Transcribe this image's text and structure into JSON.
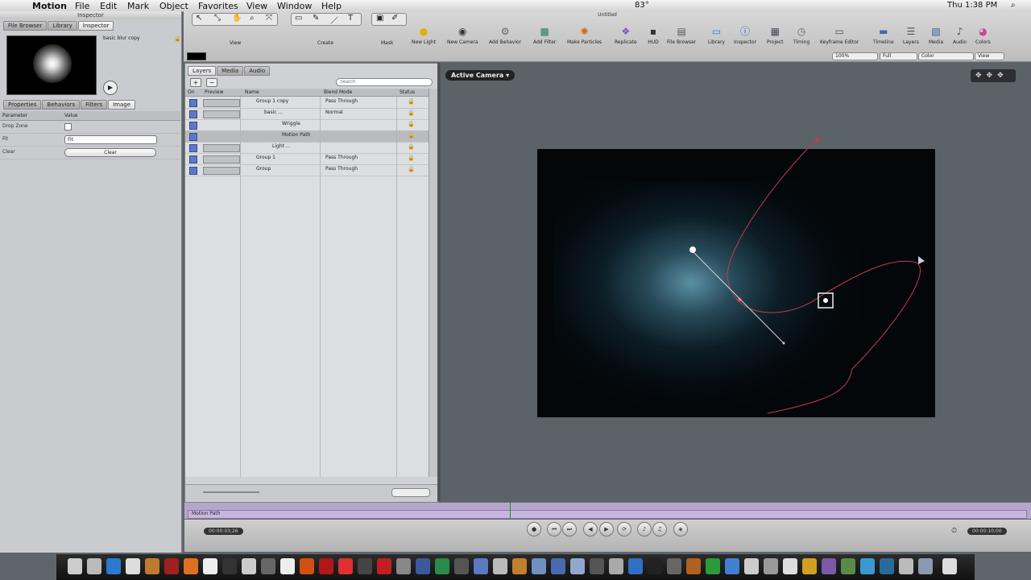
{
  "menubar": {
    "app": "Motion",
    "items": [
      "File",
      "Edit",
      "Mark",
      "Object",
      "Favorites",
      "View",
      "Window",
      "Help"
    ],
    "temp": "83°",
    "clock": "Thu 1:38 PM",
    "window_title": "Untitled"
  },
  "inspector": {
    "title": "Inspector",
    "top_tabs": [
      "File Browser",
      "Library",
      "Inspector"
    ],
    "preview_name": "basic blur copy",
    "sub_tabs": [
      "Properties",
      "Behaviors",
      "Filters",
      "Image"
    ],
    "param_header": "Parameter",
    "value_header": "Value",
    "rows": [
      {
        "label": "Drop Zone"
      },
      {
        "label": "Fit",
        "value": "Fit"
      },
      {
        "label": "Clear",
        "button": "Clear"
      }
    ]
  },
  "toolbar": {
    "group_labels": [
      "View",
      "Create",
      "Mask"
    ],
    "buttons": [
      "New Light",
      "New Camera",
      "Add Behavior",
      "Add Filter",
      "Make Particles",
      "Replicate",
      "HUD",
      "File Browser",
      "Library",
      "Inspector",
      "Project",
      "Timing",
      "Keyframe Editor",
      "Timeline",
      "Layers",
      "Media",
      "Audio",
      "Colors"
    ],
    "zoom": "100%",
    "resolution": "Full",
    "channel": "Color",
    "view": "View"
  },
  "layers": {
    "tabs": [
      "Layers",
      "Media",
      "Audio"
    ],
    "search_placeholder": "Search",
    "columns": [
      "On",
      "Preview",
      "Name",
      "Blend Mode",
      "Status"
    ],
    "rows": [
      {
        "name": "Group 1 copy",
        "blend": "Pass Through",
        "indent": 0
      },
      {
        "name": "basic ...",
        "blend": "Normal",
        "indent": 1
      },
      {
        "name": "Wriggle",
        "blend": "",
        "indent": 2
      },
      {
        "name": "Motion Path",
        "blend": "",
        "indent": 2,
        "selected": true
      },
      {
        "name": "Light ...",
        "blend": "",
        "indent": 1
      },
      {
        "name": "Group 1",
        "blend": "Pass Through",
        "indent": 0
      },
      {
        "name": "Group",
        "blend": "Pass Through",
        "indent": 0
      }
    ]
  },
  "canvas": {
    "active_camera": "Active Camera"
  },
  "timeline": {
    "track_label": "Motion Path",
    "current_time": "00:00:03;26",
    "duration": "00:00:10;00"
  },
  "colors": {
    "motion_path": "#c63a52",
    "scene_glow": "#78bed7",
    "timebar": "#b7a6cc"
  }
}
